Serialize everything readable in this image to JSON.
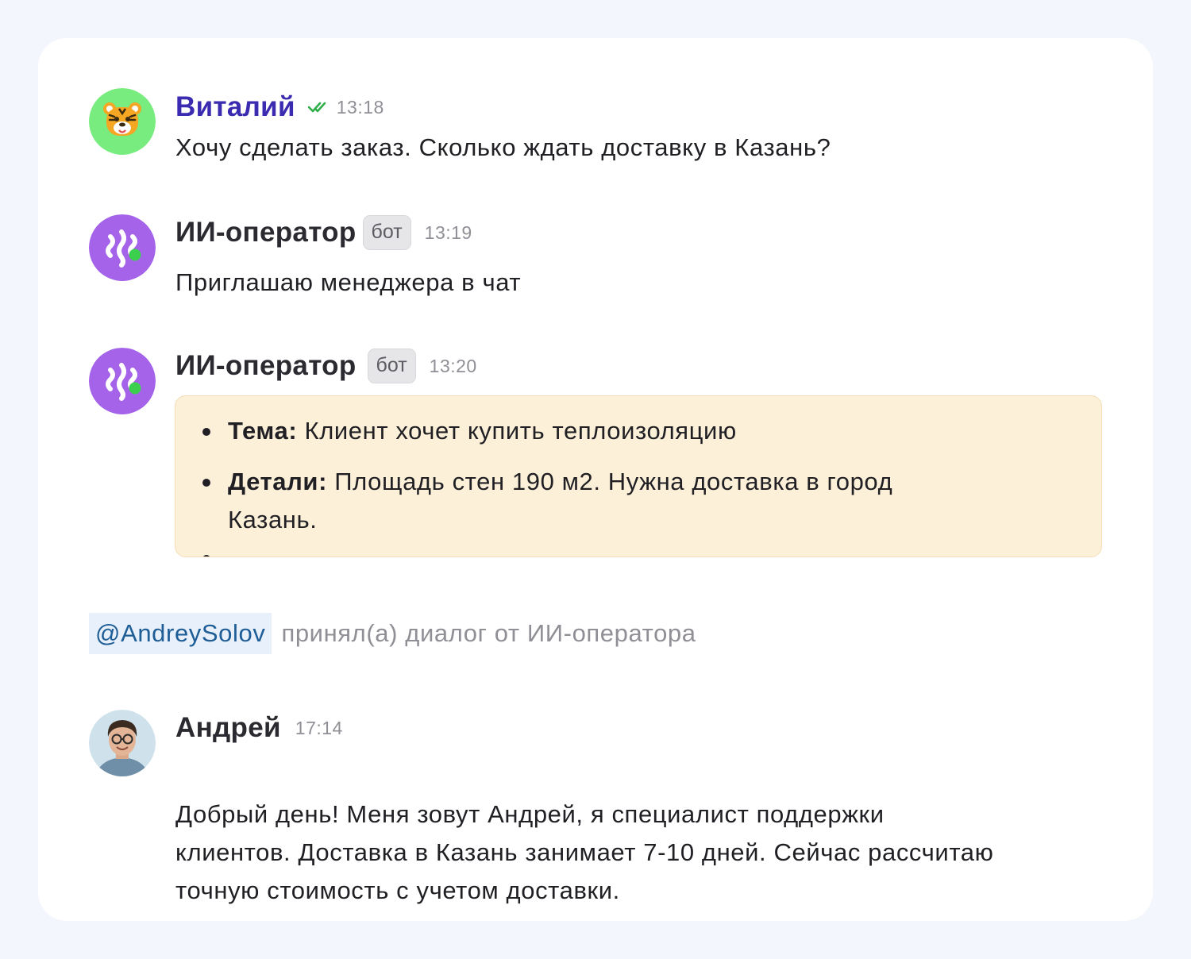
{
  "messages": [
    {
      "author": "Виталий",
      "read_status": "double-check-icon",
      "time": "13:18",
      "text": "Хочу сделать заказ. Сколько ждать доставку в Казань?"
    },
    {
      "author": "ИИ-оператор",
      "badge": "бот",
      "time": "13:19",
      "text": "Приглашаю менеджера в чат"
    },
    {
      "author": "ИИ-оператор",
      "badge": "бот",
      "time": "13:20",
      "summary": [
        {
          "label": "Тема:",
          "value": "Клиент хочет купить теплоизоляцию"
        },
        {
          "label": "Детали:",
          "value": "Площадь стен 190 м2. Нужна доставка в город",
          "value_cont": "Казань."
        }
      ]
    },
    {
      "author": "Андрей",
      "time": "17:14",
      "text_lines": [
        "Добрый день! Меня зовут Андрей, я специалист поддержки",
        "клиентов. Доставка в Казань занимает 7-10 дней. Сейчас рассчитаю",
        "точную стоимость с учетом доставки."
      ]
    }
  ],
  "system_event": {
    "mention": "@AndreySolov",
    "text": "принял(а) диалог от ИИ-оператора"
  },
  "colors": {
    "page_bg": "#f3f6fc",
    "card_bg": "#ffffff",
    "user_name": "#3a2bb0",
    "read_check": "#2fae4a",
    "bot_avatar": "#a463e8",
    "online_dot": "#3ccf4e",
    "summary_bg": "#fdf0d9",
    "mention_bg": "#e7f0fb",
    "mention_text": "#1e5d96"
  }
}
